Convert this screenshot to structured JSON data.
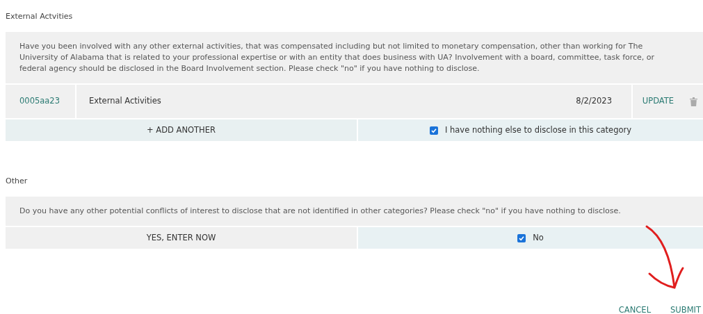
{
  "sections": [
    {
      "title": "External Actvities",
      "question": "Have you been involved with any other external activities, that was compensated including but not limited to monetary compensation, other than working for The University of Alabama that is related to your professional expertise or with an entity that does business with UA? Involvement with a board, committee, task force, or federal agency should be disclosed in the Board Involvement section. Please check \"no\" if you have nothing to disclose.",
      "entries": [
        {
          "id": "0005aa23",
          "name": "External Activities",
          "date": "8/2/2023",
          "action": "UPDATE"
        }
      ],
      "add_button": "+ ADD ANOTHER",
      "checkbox": {
        "label": "I have nothing else to disclose in this category",
        "checked": true
      }
    },
    {
      "title": "Other",
      "question": "Do you have any other potential conflicts of interest to disclose that are not identified in other categories? Please check \"no\" if you have nothing to disclose.",
      "add_button": "YES, ENTER NOW",
      "checkbox": {
        "label": "No",
        "checked": true
      }
    }
  ],
  "buttons": [
    "CANCEL",
    "SUBMIT"
  ]
}
